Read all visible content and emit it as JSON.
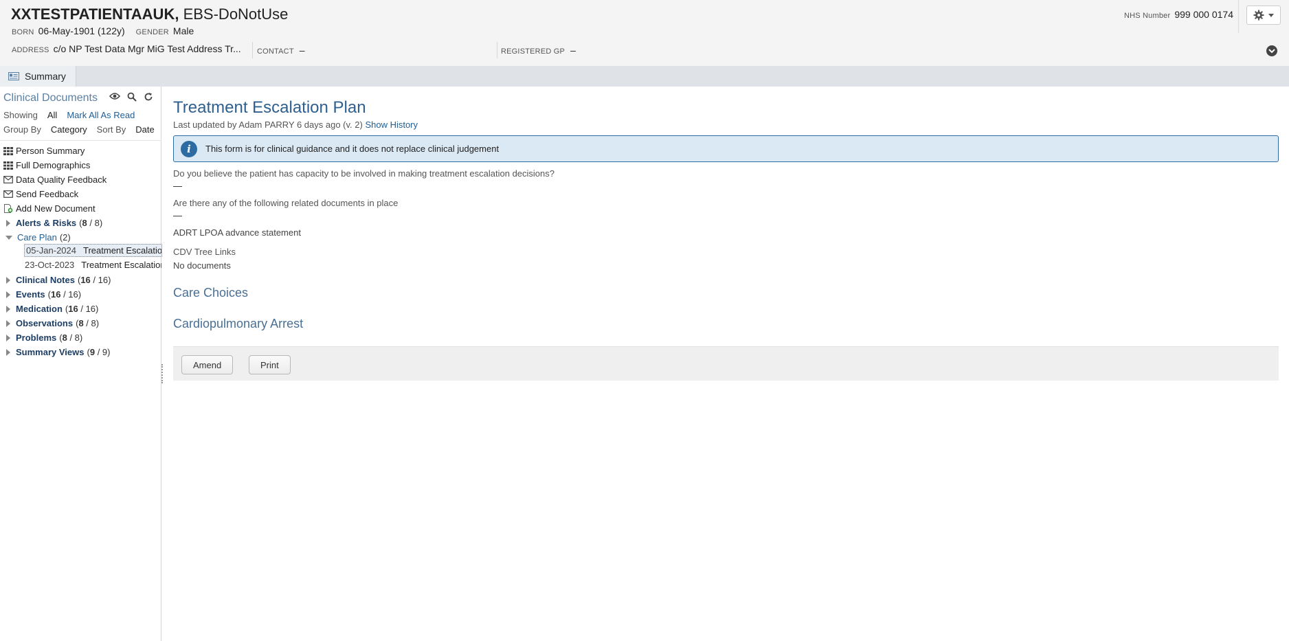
{
  "banner": {
    "patient_surname": "XXTESTPATIENTAAUK,",
    "patient_forename": "EBS-DoNotUse",
    "born_label": "BORN",
    "born_value": "06-May-1901 (122y)",
    "gender_label": "GENDER",
    "gender_value": "Male",
    "address_label": "ADDRESS",
    "address_value": "c/o NP Test Data Mgr MiG Test Address Tr...",
    "contact_label": "CONTACT",
    "contact_value": "–",
    "gp_label": "REGISTERED GP",
    "gp_value": "–",
    "nhs_label": "NHS Number",
    "nhs_value": "999 000 0174"
  },
  "tabs": [
    {
      "label": "Summary",
      "icon": "summary-card-icon"
    }
  ],
  "sidebar": {
    "title": "Clinical Documents",
    "showing_label": "Showing",
    "showing_value": "All",
    "mark_all_read": "Mark All As Read",
    "group_by_label": "Group By",
    "group_by_value": "Category",
    "sort_by_label": "Sort By",
    "sort_by_value": "Date",
    "links": [
      {
        "label": "Person Summary",
        "icon": "grid-icon"
      },
      {
        "label": "Full Demographics",
        "icon": "grid-icon"
      },
      {
        "label": "Data Quality Feedback",
        "icon": "envelope-icon"
      },
      {
        "label": "Send Feedback",
        "icon": "envelope-icon"
      },
      {
        "label": "Add New Document",
        "icon": "add-document-icon"
      }
    ],
    "categories": [
      {
        "name": "Alerts & Risks",
        "unread": "8",
        "total": "/ 8",
        "expanded": false
      },
      {
        "name": "Care Plan",
        "count": "(2)",
        "expanded": true,
        "documents": [
          {
            "date": "05-Jan-2024",
            "title": "Treatment Escalation Plan",
            "selected": true
          },
          {
            "date": "23-Oct-2023",
            "title": "Treatment Escalation Plan",
            "selected": false
          }
        ]
      },
      {
        "name": "Clinical Notes",
        "unread": "16",
        "total": "/ 16",
        "expanded": false
      },
      {
        "name": "Events",
        "unread": "16",
        "total": "/ 16",
        "expanded": false
      },
      {
        "name": "Medication",
        "unread": "16",
        "total": "/ 16",
        "expanded": false
      },
      {
        "name": "Observations",
        "unread": "8",
        "total": "/ 8",
        "expanded": false
      },
      {
        "name": "Problems",
        "unread": "8",
        "total": "/ 8",
        "expanded": false
      },
      {
        "name": "Summary Views",
        "unread": "9",
        "total": "/ 9",
        "expanded": false
      }
    ]
  },
  "document": {
    "title": "Treatment Escalation Plan",
    "updated_text": "Last updated by Adam PARRY 6 days ago (v. 2)",
    "show_history": "Show History",
    "info_text": "This form is for clinical guidance and it does not replace clinical judgement",
    "q1": "Do you believe the patient has capacity to be involved in making treatment escalation decisions?",
    "a1": "—",
    "q2": "Are there any of the following related documents in place",
    "a2": "—",
    "related_link": "ADRT LPOA advance statement",
    "cdv_label": "CDV Tree Links",
    "cdv_value": "No documents",
    "section1": "Care Choices",
    "section2": "Cardiopulmonary Arrest",
    "amend_button": "Amend",
    "print_button": "Print"
  },
  "colors": {
    "accent": "#2e5f8f",
    "link": "#1f5e95",
    "info_bg": "#dbe9f4",
    "info_border": "#2d6ca2"
  }
}
